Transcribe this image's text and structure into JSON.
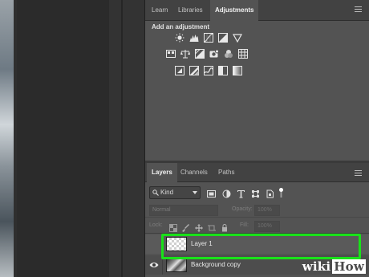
{
  "adjustments_panel": {
    "tabs": [
      {
        "label": "Learn",
        "active": false
      },
      {
        "label": "Libraries",
        "active": false
      },
      {
        "label": "Adjustments",
        "active": true
      }
    ],
    "title": "Add an adjustment",
    "rows": [
      [
        "brightness-contrast-icon",
        "levels-icon",
        "curves-icon",
        "exposure-icon",
        "gradient-triangle-icon"
      ],
      [
        "vibrance-icon",
        "balance-icon",
        "black-white-icon",
        "photo-filter-icon",
        "channel-mixer-icon",
        "color-lookup-icon"
      ],
      [
        "invert-icon",
        "posterize-icon",
        "threshold-icon",
        "selective-color-icon",
        "gradient-map-icon"
      ]
    ]
  },
  "layers_panel": {
    "tabs": [
      {
        "label": "Layers",
        "active": true
      },
      {
        "label": "Channels",
        "active": false
      },
      {
        "label": "Paths",
        "active": false
      }
    ],
    "filter": {
      "kind_label": "Kind"
    },
    "blend_mode": "Normal",
    "opacity_label": "Opacity:",
    "opacity_value": "100%",
    "lock_label": "Lock:",
    "fill_label": "Fill:",
    "fill_value": "100%",
    "layers": [
      {
        "name": "Layer 1",
        "visible": false,
        "selected": true
      },
      {
        "name": "Background copy",
        "visible": true,
        "selected": false
      }
    ]
  },
  "highlight_color": "#19e219",
  "watermark": {
    "prefix": "wiki",
    "suffix": "How"
  }
}
